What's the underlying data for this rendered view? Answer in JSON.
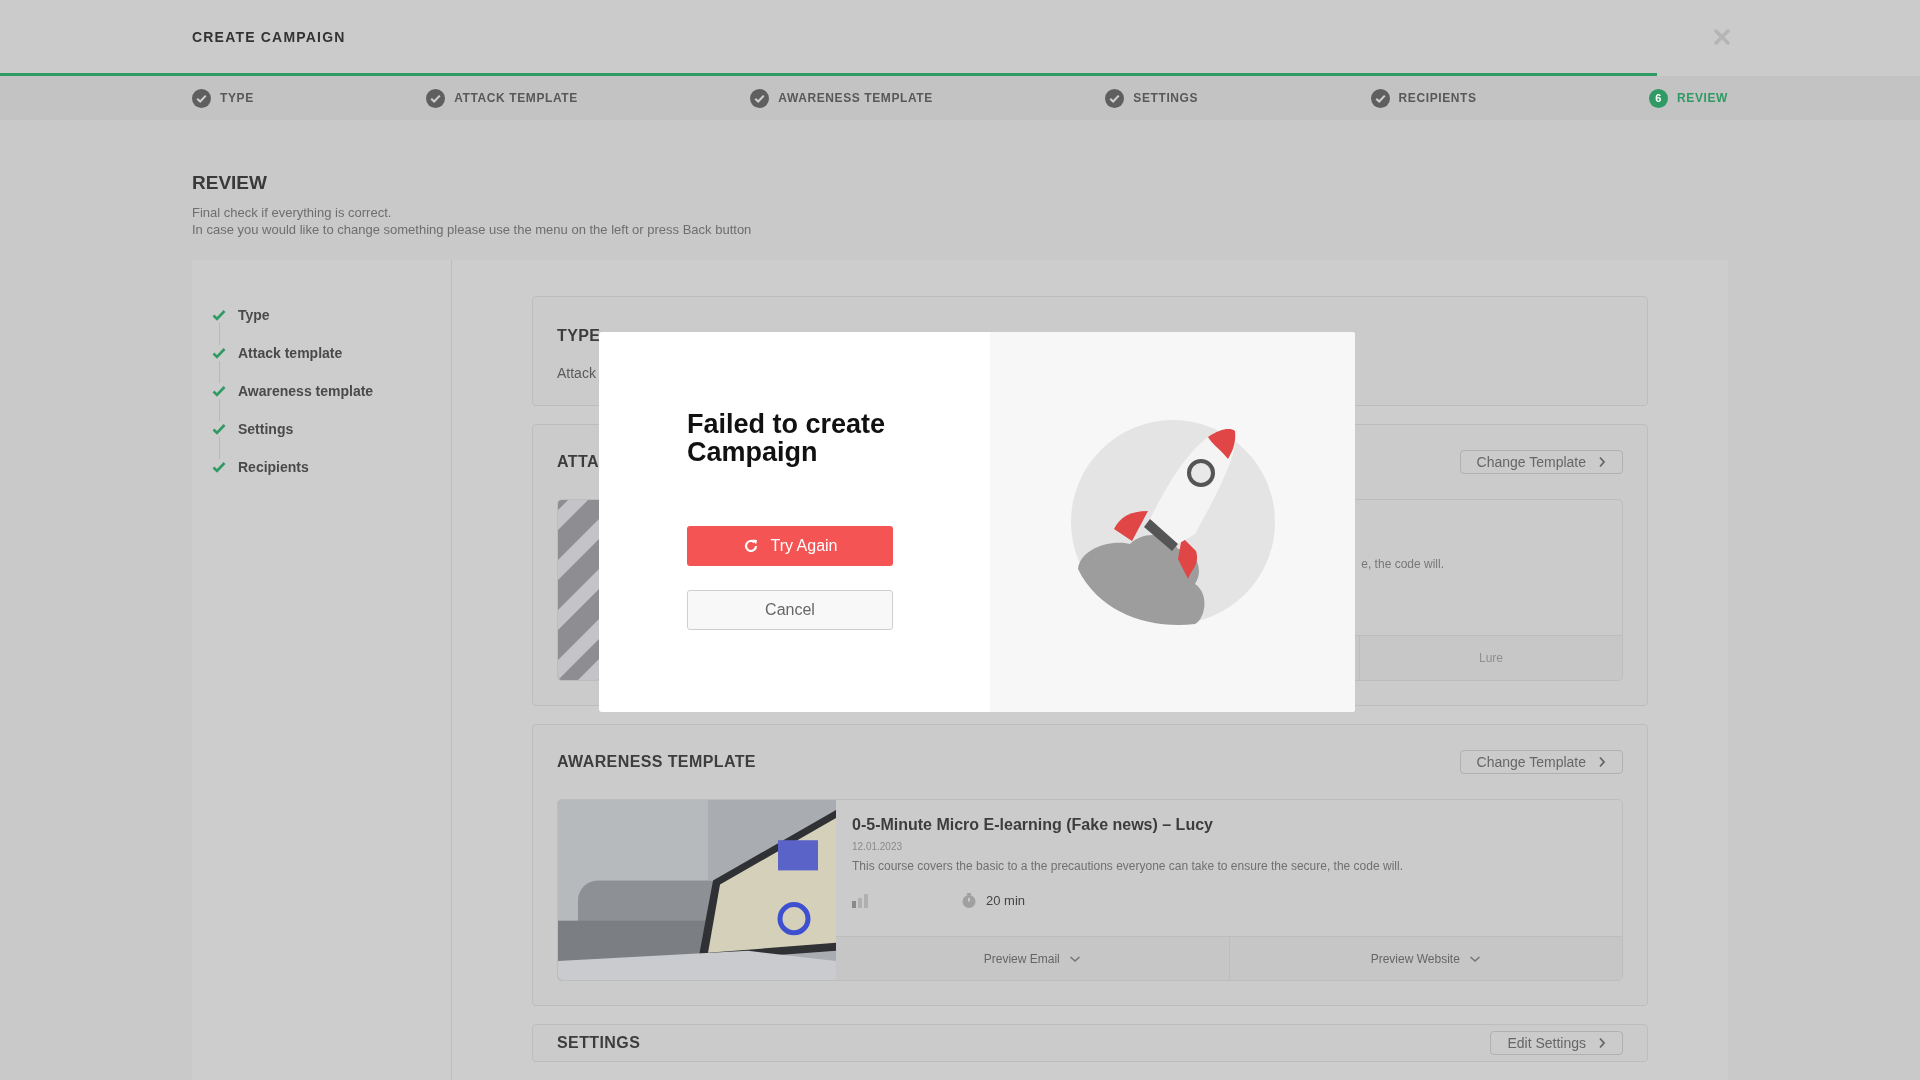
{
  "header": {
    "title": "CREATE CAMPAIGN"
  },
  "progress": {
    "level": 0.863
  },
  "steps": [
    {
      "label": "TYPE",
      "done": true,
      "selected": false
    },
    {
      "label": "ATTACK TEMPLATE",
      "done": true,
      "selected": false
    },
    {
      "label": "AWARENESS TEMPLATE",
      "done": true,
      "selected": false
    },
    {
      "label": "SETTINGS",
      "done": true,
      "selected": false
    },
    {
      "label": "RECIPIENTS",
      "done": true,
      "selected": false
    },
    {
      "label": "REVIEW",
      "number": "6",
      "done": false,
      "selected": true
    }
  ],
  "review": {
    "title": "REVIEW",
    "lines": [
      "Final check if everything is correct.",
      "In case you would like to change something please use the menu on the left or press Back button"
    ]
  },
  "sidebar": {
    "items": [
      {
        "label": "Type",
        "checked": true
      },
      {
        "label": "Attack template",
        "checked": true
      },
      {
        "label": "Awareness template",
        "checked": true
      },
      {
        "label": "Settings",
        "checked": true
      },
      {
        "label": "Recipients",
        "checked": true
      }
    ]
  },
  "sections": [
    {
      "kind": "type",
      "title": "TYPE",
      "value": "Attack"
    },
    {
      "kind": "attack",
      "title": "ATTA",
      "button": "Change Template",
      "description": "e, the code will.",
      "tab": "Lure"
    },
    {
      "kind": "awareness",
      "title": "AWARENESS TEMPLATE",
      "button": "Change Template",
      "item": {
        "title": "0-5-Minute Micro E-learning (Fake news) – Lucy",
        "date": "12.01.2023",
        "description": "This course covers the basic to a the precautions everyone can take to ensure the secure, the code will.",
        "duration": "20 min",
        "actions": [
          "Preview Email",
          "Preview Website"
        ]
      }
    },
    {
      "kind": "settings",
      "title": "SETTINGS",
      "button": "Edit Settings"
    }
  ],
  "modal": {
    "title": "Failed to create Campaign",
    "buttons": [
      {
        "kind": "primary",
        "label": "Try Again"
      },
      {
        "kind": "secondary",
        "label": "Cancel"
      }
    ]
  }
}
